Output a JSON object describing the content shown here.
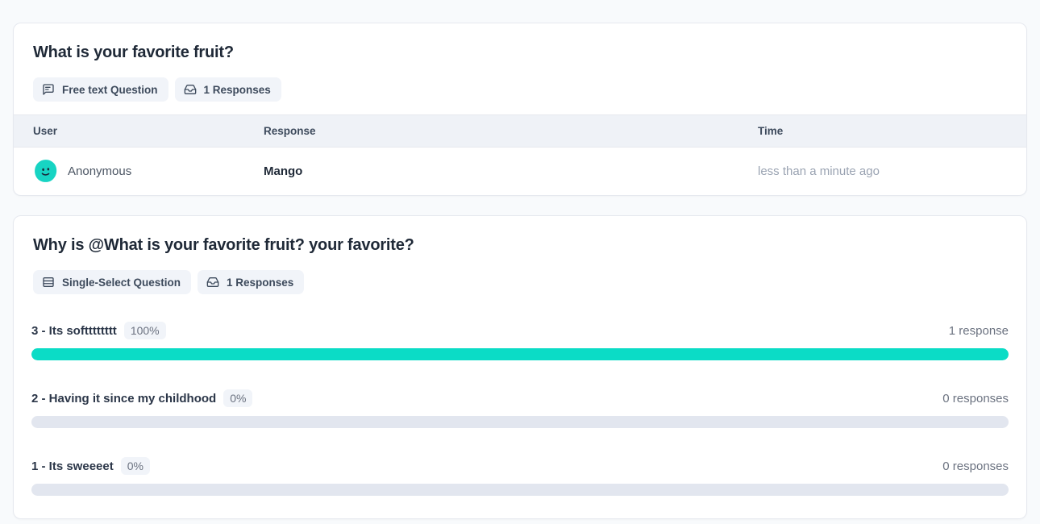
{
  "theme": {
    "page_bg": "#F8FAFC",
    "card_bg": "#FFFFFF",
    "card_border": "#E6E9EF",
    "accent_teal": "#0BDCC6",
    "track_gray": "#E2E6EF",
    "table_header_bg": "#EFF2F7",
    "badge_bg": "#F1F4F9",
    "title_color": "#1F2937",
    "muted_color": "#9AA3B2"
  },
  "cards": [
    {
      "title": "What is your favorite fruit?",
      "badges": [
        {
          "icon": "message-square-icon",
          "label": "Free text Question"
        },
        {
          "icon": "inbox-icon",
          "label": "1 Responses"
        }
      ],
      "table": {
        "columns": [
          "User",
          "Response",
          "Time"
        ],
        "rows": [
          {
            "avatar": "anonymous-blob-avatar",
            "user": "Anonymous",
            "response": "Mango",
            "time": "less than a minute ago"
          }
        ]
      }
    },
    {
      "title": "Why is @What is your favorite fruit? your favorite?",
      "badges": [
        {
          "icon": "rows-list-icon",
          "label": "Single-Select Question"
        },
        {
          "icon": "inbox-icon",
          "label": "1 Responses"
        }
      ],
      "options": [
        {
          "label": "3 - Its softttttttt",
          "percent": "100%",
          "count": "1 response",
          "fill": 100
        },
        {
          "label": "2 - Having it since my childhood",
          "percent": "0%",
          "count": "0 responses",
          "fill": 0
        },
        {
          "label": "1 - Its sweeeet",
          "percent": "0%",
          "count": "0 responses",
          "fill": 0
        }
      ]
    }
  ]
}
